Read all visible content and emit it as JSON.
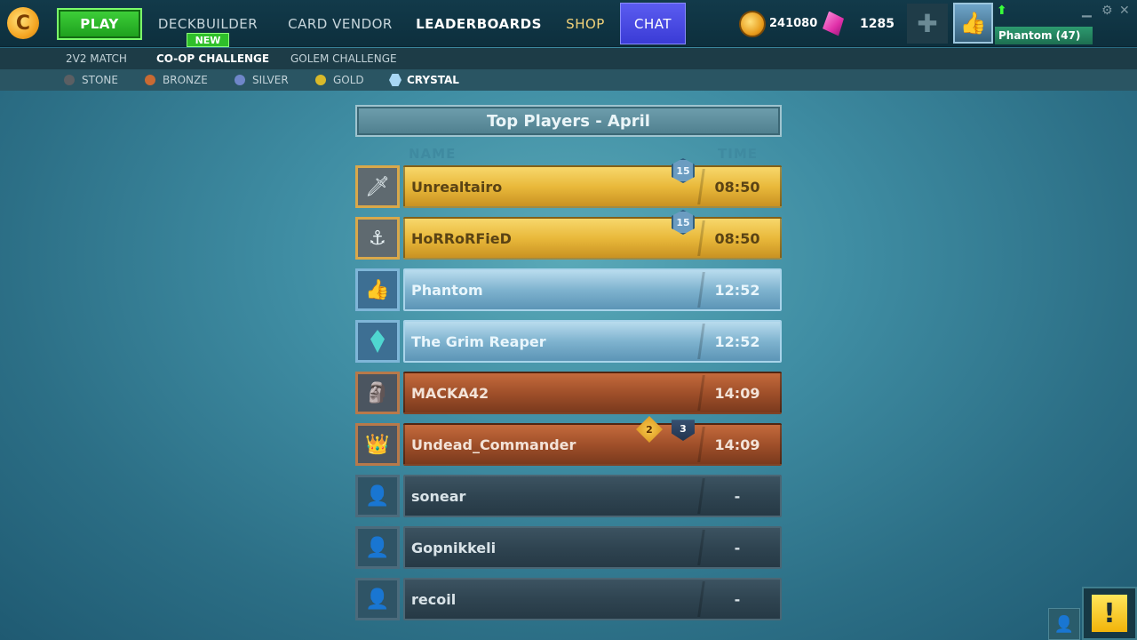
{
  "nav": {
    "play": "PLAY",
    "deckbuilder": "DECKBUILDER",
    "new_badge": "NEW",
    "card_vendor": "CARD VENDOR",
    "leaderboards": "LEADERBOARDS",
    "shop": "SHOP",
    "chat": "CHAT"
  },
  "currency": {
    "gold": "241080",
    "gems": "1285"
  },
  "profile": {
    "name": "Phantom (47)"
  },
  "modes": [
    "2V2 MATCH",
    "CO-OP CHALLENGE",
    "GOLEM CHALLENGE"
  ],
  "tiers": [
    "STONE",
    "BRONZE",
    "SILVER",
    "GOLD",
    "CRYSTAL"
  ],
  "leaderboard": {
    "title": "Top Players - April",
    "col_name": "NAME",
    "col_time": "TIME",
    "rows": [
      {
        "name": "Unrealtairo",
        "time": "08:50",
        "tier": "gold",
        "badge": "15"
      },
      {
        "name": "HoRRoRFieD",
        "time": "08:50",
        "tier": "gold",
        "badge": "15"
      },
      {
        "name": "Phantom",
        "time": "12:52",
        "tier": "crystal"
      },
      {
        "name": "The Grim Reaper",
        "time": "12:52",
        "tier": "crystal"
      },
      {
        "name": "MACKA42",
        "time": "14:09",
        "tier": "bronze"
      },
      {
        "name": "Undead_Commander",
        "time": "14:09",
        "tier": "bronze",
        "badge_a": "2",
        "badge_b": "3"
      },
      {
        "name": "sonear",
        "time": "-",
        "tier": "stone"
      },
      {
        "name": "Gopnikkeli",
        "time": "-",
        "tier": "stone"
      },
      {
        "name": "recoil",
        "time": "-",
        "tier": "stone"
      }
    ]
  },
  "icons": {
    "logo": "game-logo-icon",
    "coin": "gold-coin-icon",
    "gem": "gem-icon",
    "plus": "plus-icon",
    "avatar": "thumbs-up-avatar-icon",
    "alert": "exclamation-icon"
  }
}
